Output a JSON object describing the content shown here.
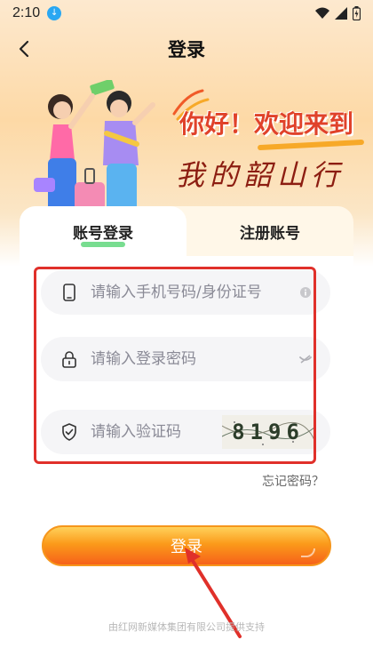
{
  "status_bar": {
    "time": "2:10",
    "download_icon": "download-icon",
    "icons": [
      "wifi-icon",
      "signal-icon",
      "battery-icon"
    ]
  },
  "nav": {
    "title": "登录",
    "back_icon": "chevron-left-icon"
  },
  "banner": {
    "greeting": "你好！欢迎来到",
    "slogan": "我的韶山行"
  },
  "tabs": [
    {
      "label": "账号登录",
      "active": true
    },
    {
      "label": "注册账号",
      "active": false
    }
  ],
  "form": {
    "phone": {
      "placeholder": "请输入手机号码/身份证号",
      "value": "",
      "icon": "phone-icon",
      "trailing_icon": "info-icon"
    },
    "password": {
      "placeholder": "请输入登录密码",
      "value": "",
      "icon": "lock-icon",
      "trailing_icon": "eye-closed-icon"
    },
    "captcha": {
      "placeholder": "请输入验证码",
      "value": "",
      "icon": "shield-check-icon",
      "code": "8196"
    },
    "forgot_label": "忘记密码？",
    "submit_label": "登录"
  },
  "footer": {
    "text": "由红网新媒体集团有限公司提供支持"
  },
  "colors": {
    "accent_orange": "#f6961c",
    "title_red": "#e0422a",
    "annotation_red": "#e0302a",
    "tab_green": "#4bd16b"
  }
}
